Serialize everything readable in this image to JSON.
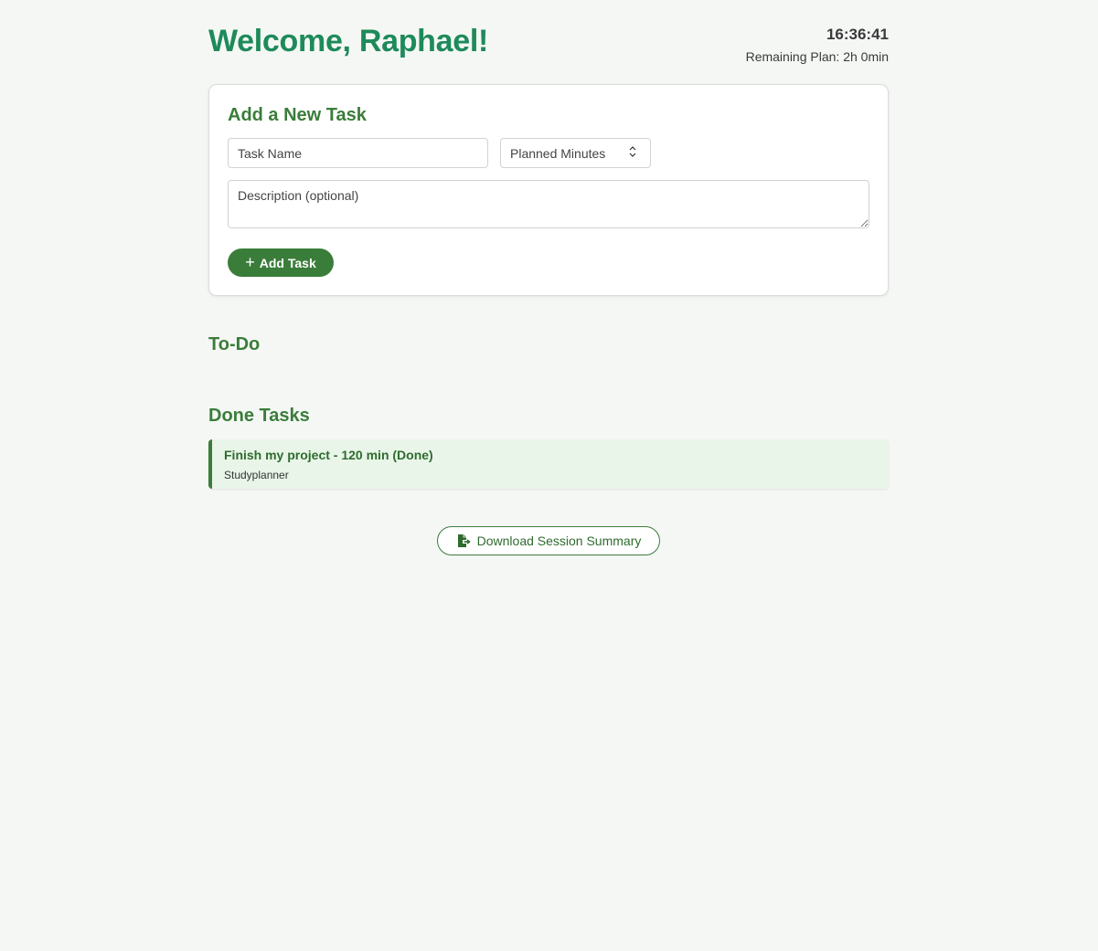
{
  "header": {
    "welcome": "Welcome, Raphael!",
    "clock": "16:36:41",
    "remaining_plan": "Remaining Plan: 2h 0min"
  },
  "add_task": {
    "title": "Add a New Task",
    "task_name_placeholder": "Task Name",
    "minutes_placeholder": "Planned Minutes",
    "description_placeholder": "Description (optional)",
    "add_button_icon": "plus-icon",
    "add_button_label": "Add Task"
  },
  "todo": {
    "title": "To-Do",
    "items": []
  },
  "done": {
    "title": "Done Tasks",
    "items": [
      {
        "title": "Finish my project - 120 min (Done)",
        "description": "Studyplanner"
      }
    ]
  },
  "download": {
    "icon": "file-export-icon",
    "label": "Download Session Summary"
  },
  "colors": {
    "accent": "#3a7d3a",
    "welcome": "#1e8a5a",
    "done_bg": "#e8f5e8",
    "page_bg": "#f5f7f5"
  }
}
